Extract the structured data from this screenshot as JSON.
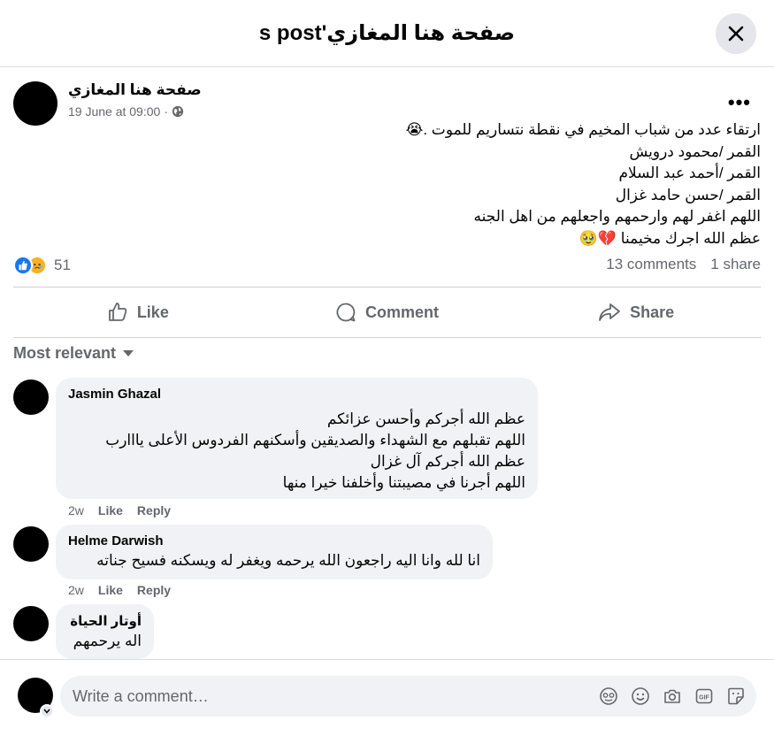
{
  "header": {
    "title": "صفحة هنا المغازي's post"
  },
  "post": {
    "author": "صفحة هنا المغازي",
    "date": "19 June at 09:00",
    "more_label": "•••",
    "lines": [
      "ارتقاء عدد من شباب المخيم في نقطة نتساريم للموت .😭",
      "القمر /محمود درويش",
      "القمر /أحمد عبد السلام",
      "القمر /حسن حامد غزال",
      "اللهم اغفر لهم وارحمهم واجعلهم من اهل الجنه",
      "عظم الله اجرك مخيمنا 💔🥹"
    ],
    "reaction_count": "51",
    "comments_count": "13 comments",
    "shares_count": "1 share"
  },
  "actions": {
    "like": "Like",
    "comment": "Comment",
    "share": "Share"
  },
  "sort_label": "Most relevant",
  "comments": [
    {
      "author": "Jasmin Ghazal",
      "lines": [
        "عظم الله أجركم وأحسن عزائكم",
        "اللهم تقبلهم مع الشهداء والصديقين وأسكنهم الفردوس الأعلى يااارب",
        "عظم الله أجركم آل غزال",
        "اللهم أجرنا في مصيبتنا وأخلفنا خيرا منها"
      ],
      "age": "2w",
      "like": "Like",
      "reply": "Reply"
    },
    {
      "author": "Helme Darwish",
      "lines": [
        "انا لله وانا اليه راجعون الله يرحمه ويغفر له ويسكنه فسيح جناته"
      ],
      "age": "2w",
      "like": "Like",
      "reply": "Reply"
    },
    {
      "author": "أوتار الحياة",
      "lines": [
        "اله يرحمهم"
      ]
    }
  ],
  "composer": {
    "placeholder": "Write a comment…"
  },
  "colors": {
    "accent": "#1877f2",
    "muted": "#65676b",
    "bubble": "#f0f2f5"
  }
}
